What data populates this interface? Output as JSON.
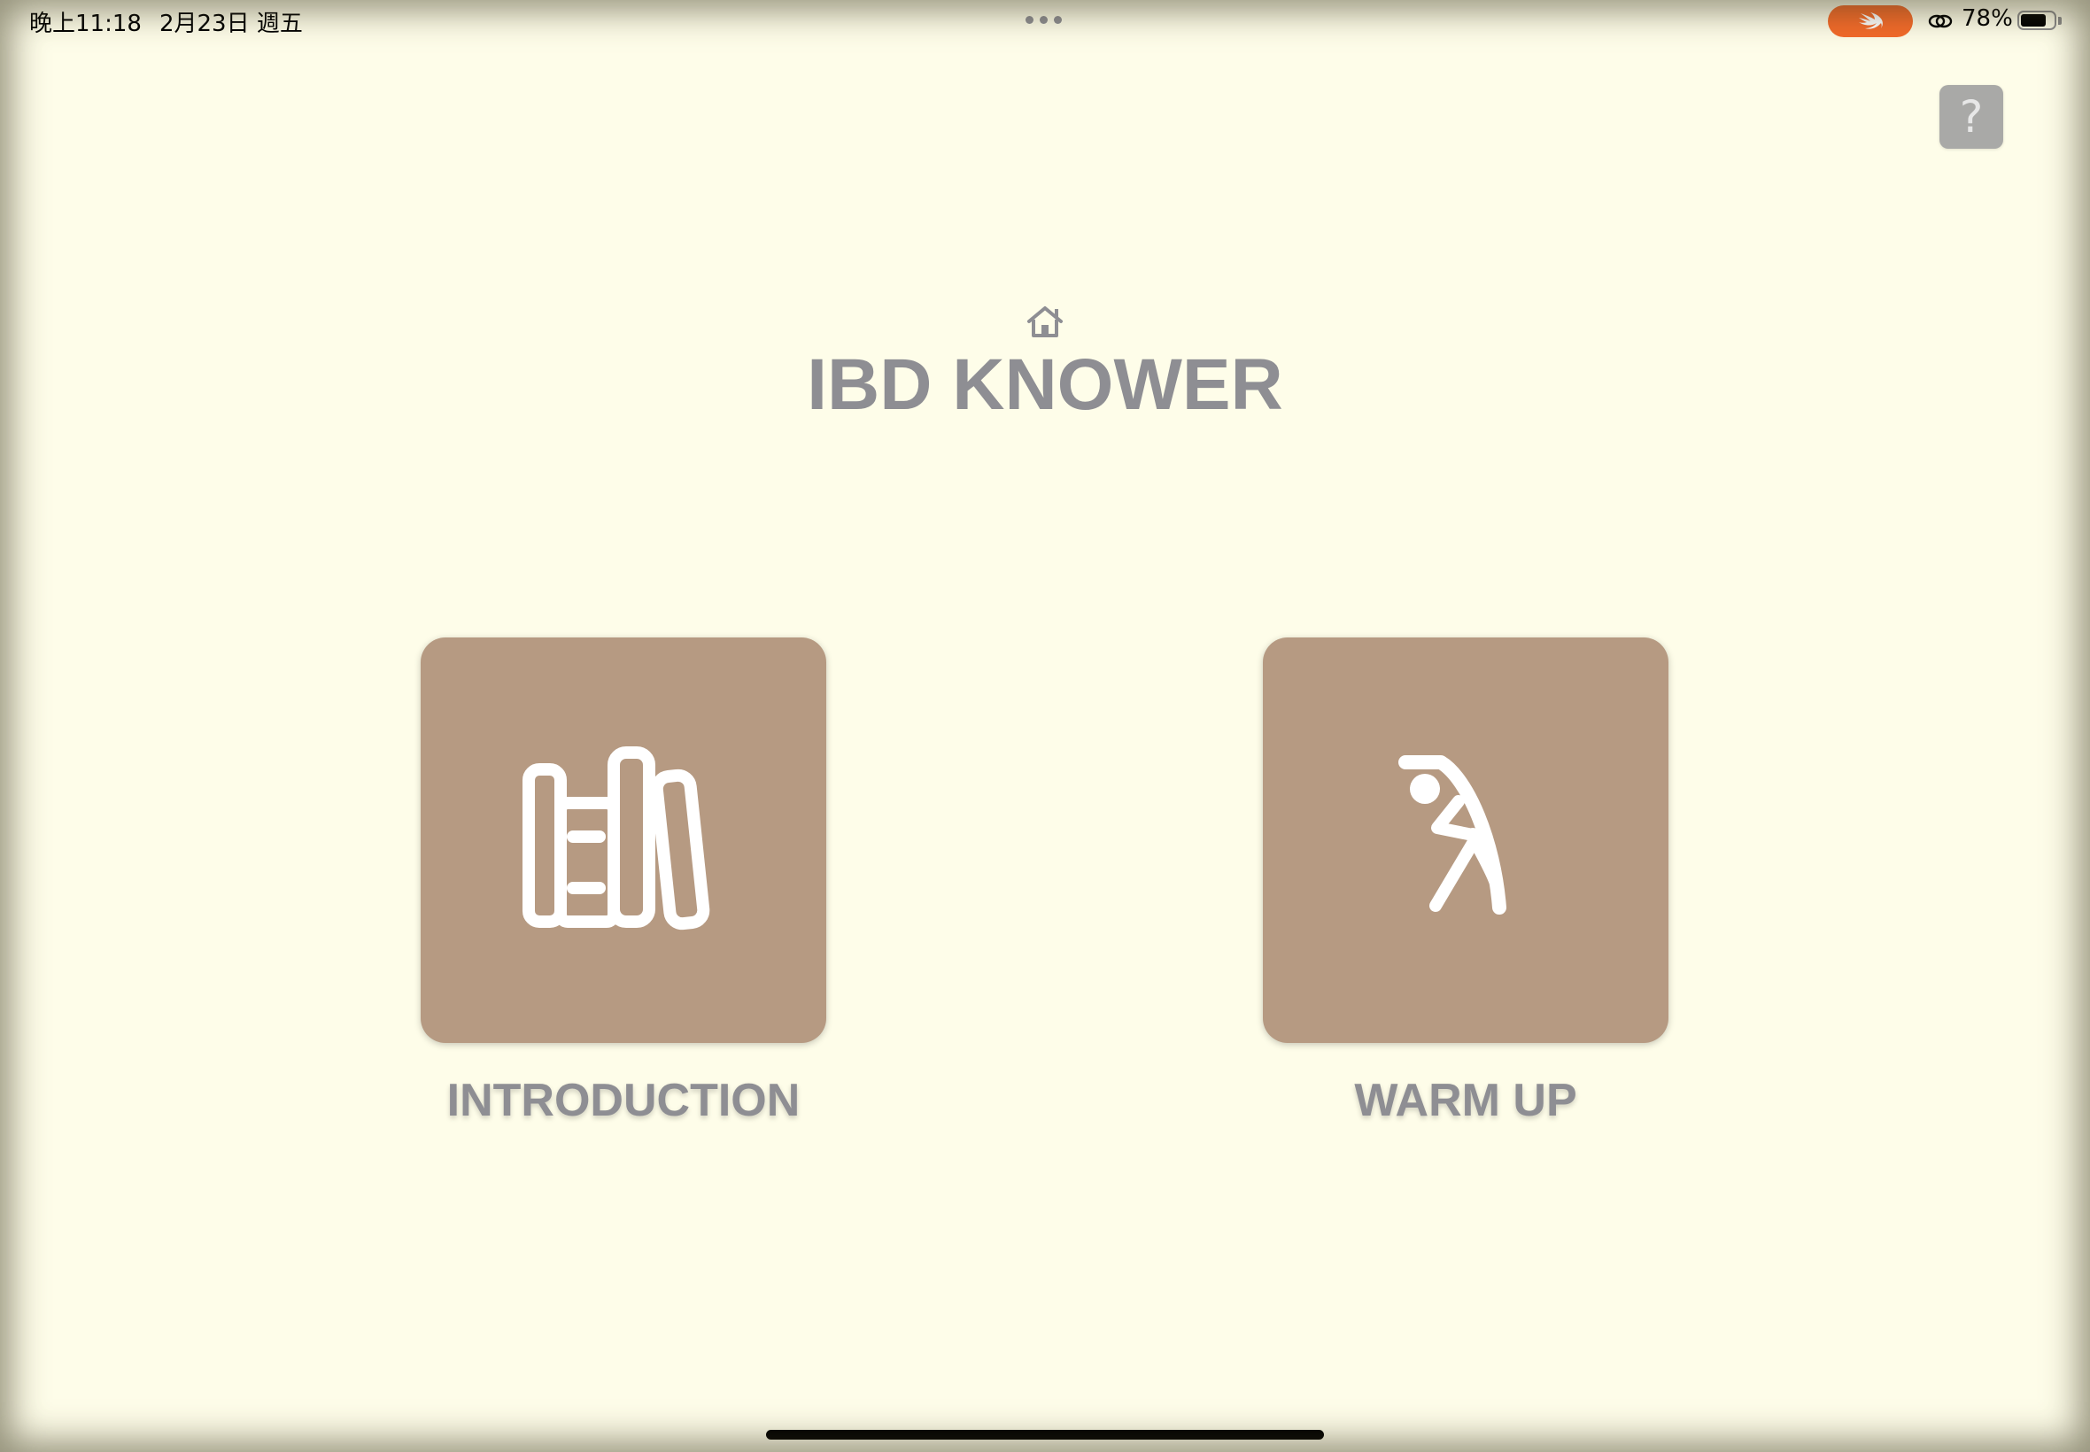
{
  "status_bar": {
    "time": "晚上11:18",
    "date": "2月23日 週五",
    "battery_percent": "78%",
    "battery_level": 0.78
  },
  "help": {
    "label": "?"
  },
  "header": {
    "title": "IBD KNOWER"
  },
  "tiles": [
    {
      "label": "INTRODUCTION",
      "icon": "books-icon"
    },
    {
      "label": "WARM UP",
      "icon": "stretching-figure-icon"
    }
  ],
  "colors": {
    "background": "#fefde9",
    "tile": "#b69a82",
    "title_text": "#8e8e93",
    "swift_pill": "#f56b2a",
    "help_button": "#a9a9a7"
  }
}
